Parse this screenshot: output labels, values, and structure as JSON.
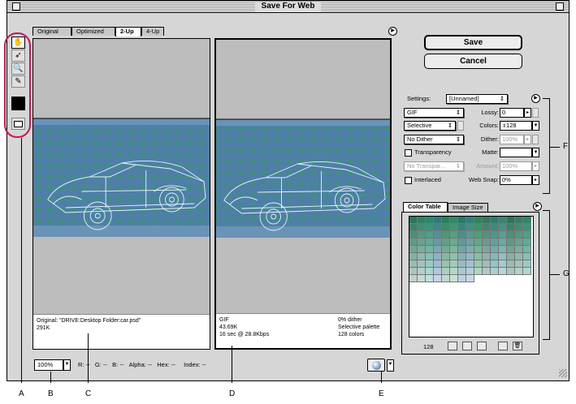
{
  "window": {
    "title": "Save For Web"
  },
  "tabs": [
    {
      "label": "Original"
    },
    {
      "label": "Optimized"
    },
    {
      "label": "2-Up",
      "active": true
    },
    {
      "label": "4-Up"
    }
  ],
  "tools": [
    "hand-tool",
    "slice-select-tool",
    "zoom-tool",
    "eyedropper-tool",
    "eyedropper-color",
    "toggle-slices-visibility"
  ],
  "buttons": {
    "save": "Save",
    "cancel": "Cancel"
  },
  "original_info": {
    "line1": "Original: \"DRIVE:Desktop Folder:car.psd\"",
    "line2": "291K"
  },
  "optimized_info": {
    "format": "GIF",
    "size": "43.69K",
    "time": "16 sec @ 28.8Kbps",
    "dither": "0% dither",
    "palette": "Selective palette",
    "colors": "128 colors"
  },
  "status": {
    "zoom": "100%",
    "r_label": "R:",
    "r_val": "--",
    "g_label": "G:",
    "g_val": "--",
    "b_label": "B:",
    "b_val": "--",
    "alpha_label": "Alpha:",
    "alpha_val": "--",
    "hex_label": "Hex:",
    "hex_val": "--",
    "index_label": "Index:",
    "index_val": "--"
  },
  "settings": {
    "settings_label": "Settings:",
    "preset": "[Unnamed]",
    "format": "GIF",
    "lossy_label": "Lossy:",
    "lossy": "0",
    "reduction": "Selective",
    "colors_label": "Colors:",
    "colors": "128",
    "dither_algo": "No Dither",
    "dither_label": "Dither:",
    "dither": "100%",
    "transparency_label": "Transparency",
    "matte_label": "Matte:",
    "matte": "",
    "trans_dither": "No Transpar...",
    "amount_label": "Amount:",
    "amount": "100%",
    "interlaced_label": "Interlaced",
    "websnap_label": "Web Snap:",
    "websnap": "0%"
  },
  "color_table": {
    "tab1": "Color Table",
    "tab2": "Image Size",
    "count": "128"
  },
  "callouts": [
    "A",
    "B",
    "C",
    "D",
    "E",
    "F",
    "G"
  ],
  "colors": {
    "highlight": "#c0185a",
    "image_blue": "#4e7fa6",
    "image_green": "#3a8a6a"
  }
}
